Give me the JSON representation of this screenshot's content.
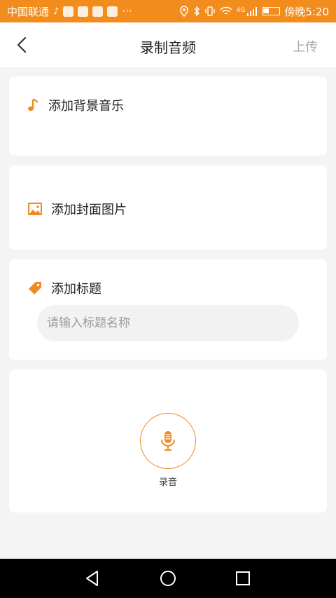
{
  "status_bar": {
    "carrier": "中国联通",
    "time": "傍晚5:20",
    "network": "4G",
    "more": "···"
  },
  "nav": {
    "title": "录制音频",
    "upload_label": "上传"
  },
  "sections": {
    "bgm_label": "添加背景音乐",
    "cover_label": "添加封面图片",
    "title_label": "添加标题",
    "title_placeholder": "请输入标题名称",
    "title_value": "",
    "record_label": "录音"
  },
  "colors": {
    "accent": "#f08a24",
    "status_bar": "#f28c1c",
    "background": "#f4f4f4"
  },
  "icons": {
    "bgm": "music-note-icon",
    "cover": "image-icon",
    "title": "tag-icon",
    "record": "microphone-icon"
  }
}
